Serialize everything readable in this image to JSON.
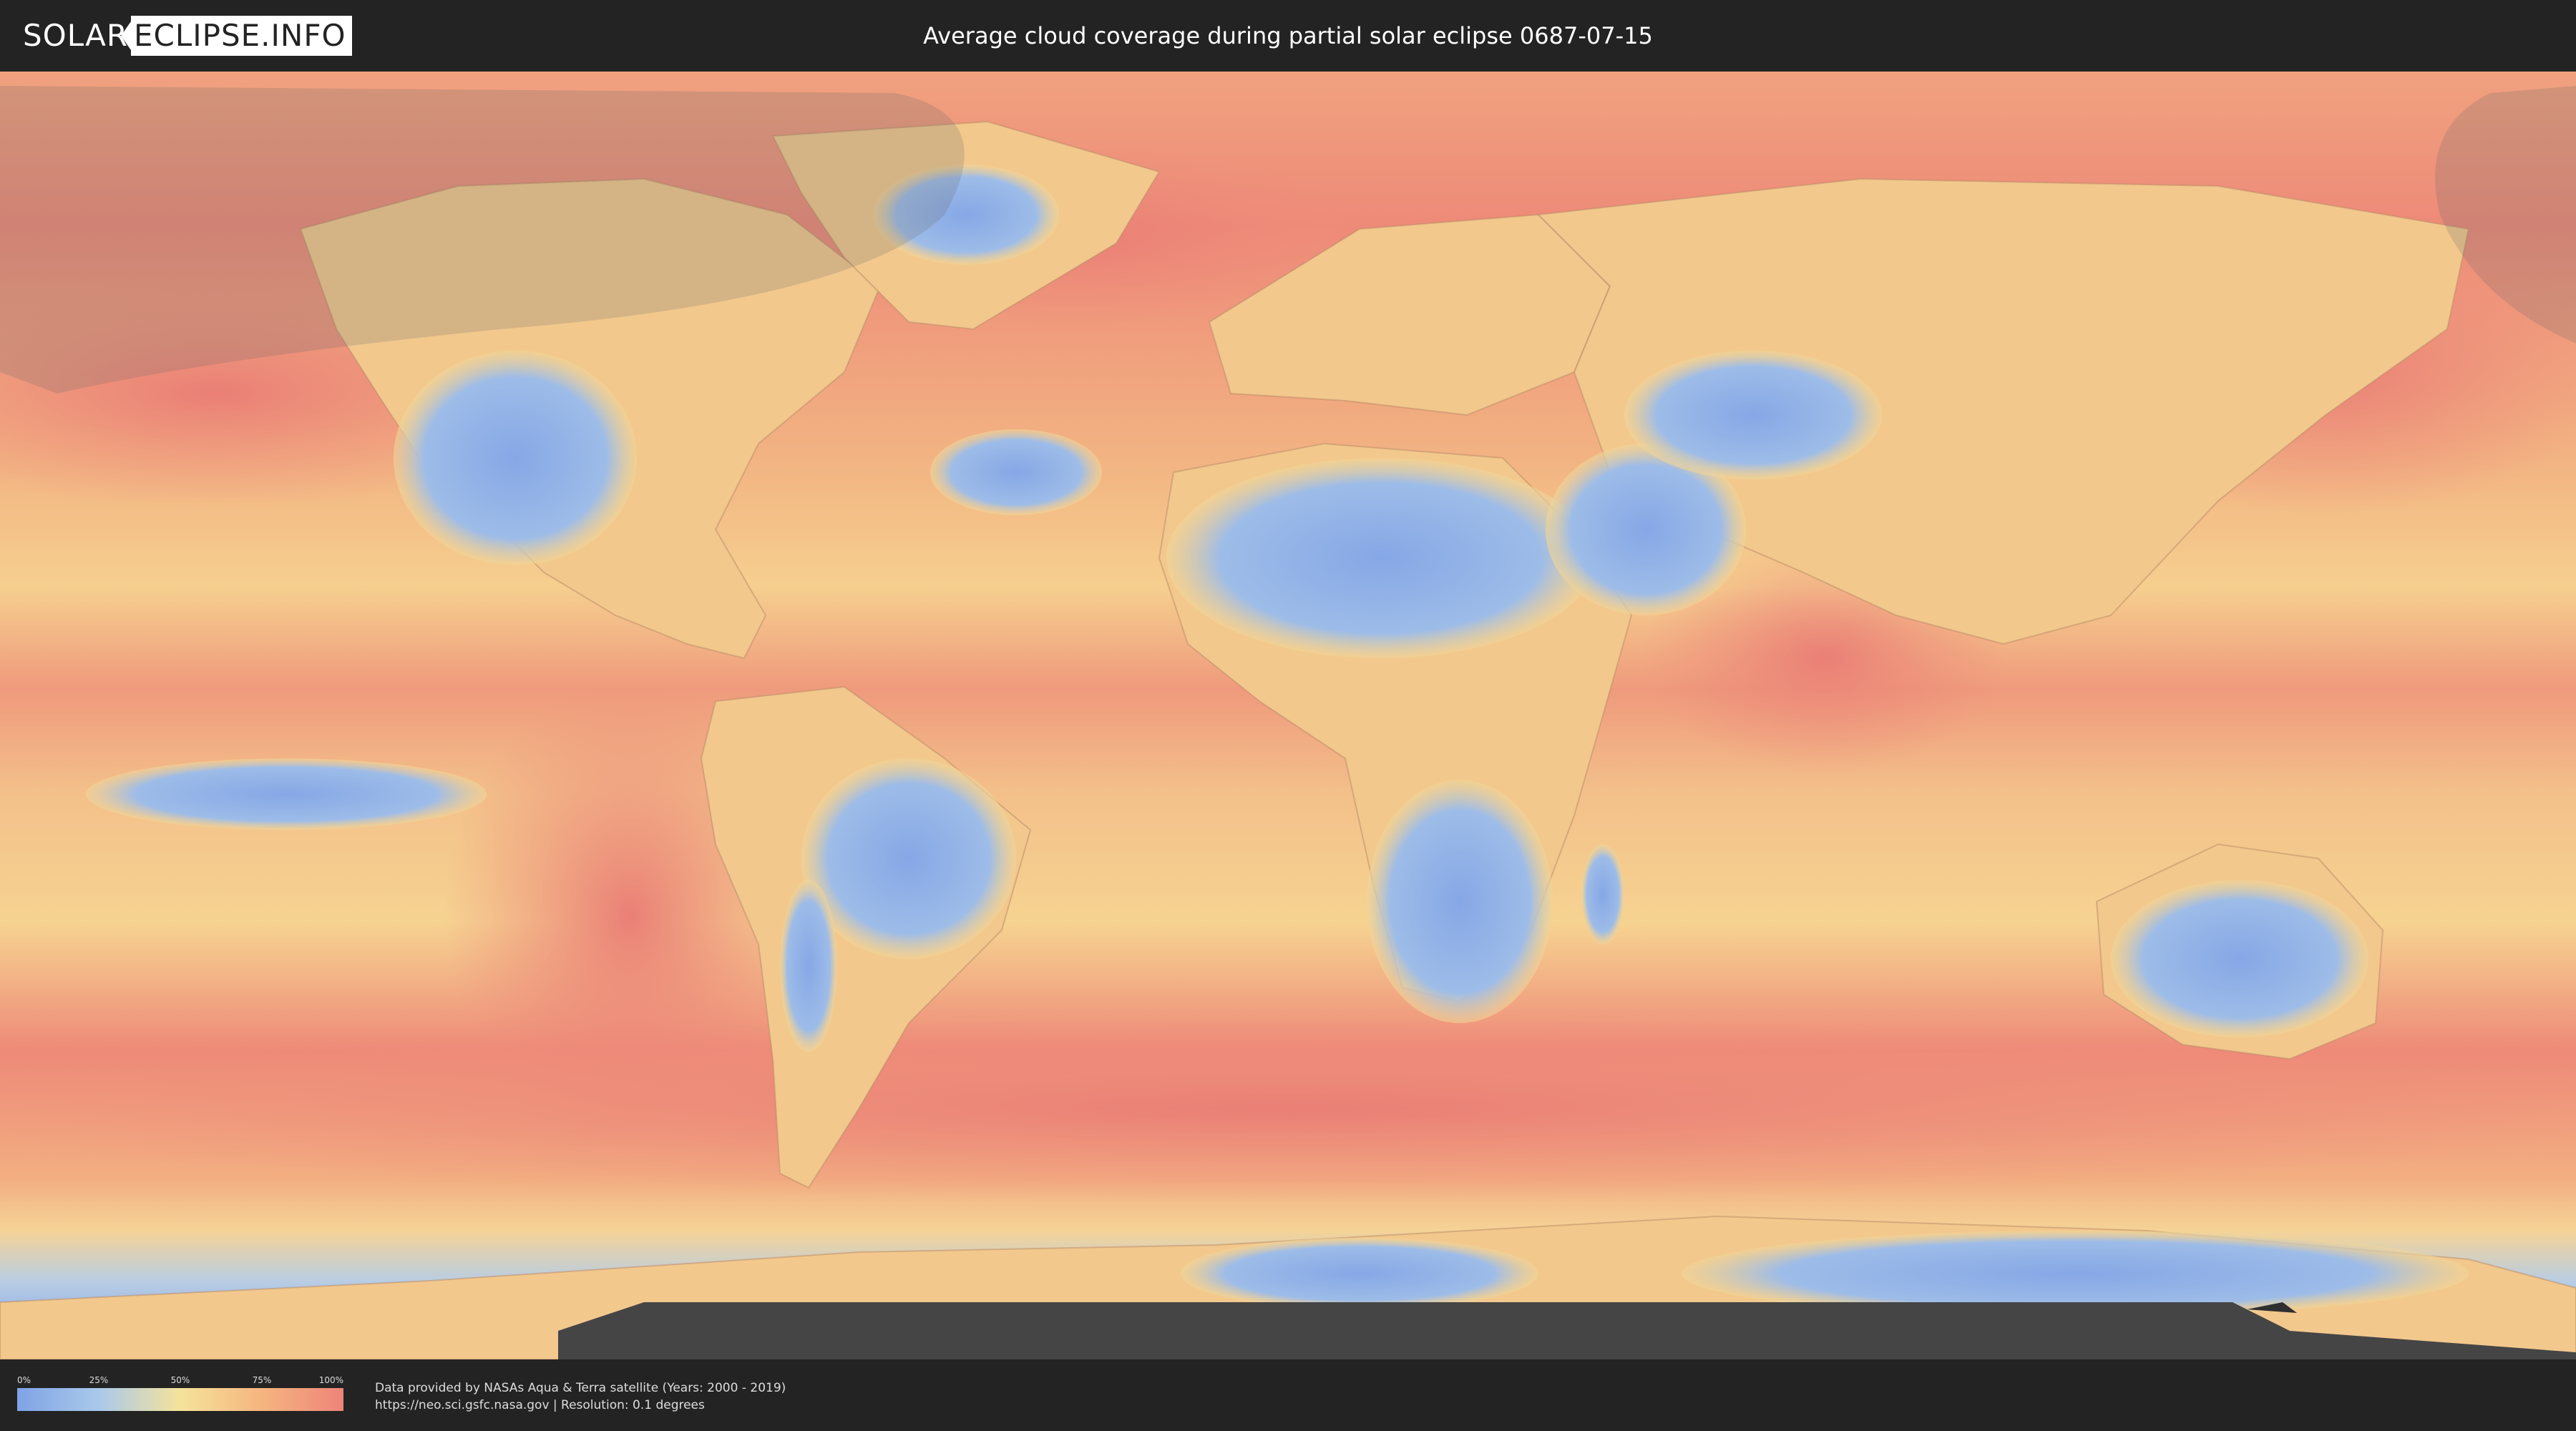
{
  "header": {
    "logo_part1": "SOLAR",
    "logo_part2": "ECLIPSE.INFO",
    "title": "Average cloud coverage during partial solar eclipse 0687-07-15"
  },
  "legend": {
    "ticks": [
      "0%",
      "25%",
      "50%",
      "75%",
      "100%"
    ],
    "colors": [
      "#7fa3e6",
      "#a9c9ea",
      "#f5e39a",
      "#f5b57f",
      "#ee8479"
    ]
  },
  "credits": {
    "line1": "Data provided by NASAs Aqua & Terra satellite (Years: 2000 - 2019)",
    "line2": "https://neo.sci.gsfc.nasa.gov | Resolution: 0.1 degrees"
  },
  "map": {
    "ocean_color": "#ee8e7c",
    "clear_land_color": "#8eaee8",
    "mid_color": "#f5d697",
    "eclipse_shadow_color": "#6b6b6b",
    "nodata_color": "#454545"
  }
}
